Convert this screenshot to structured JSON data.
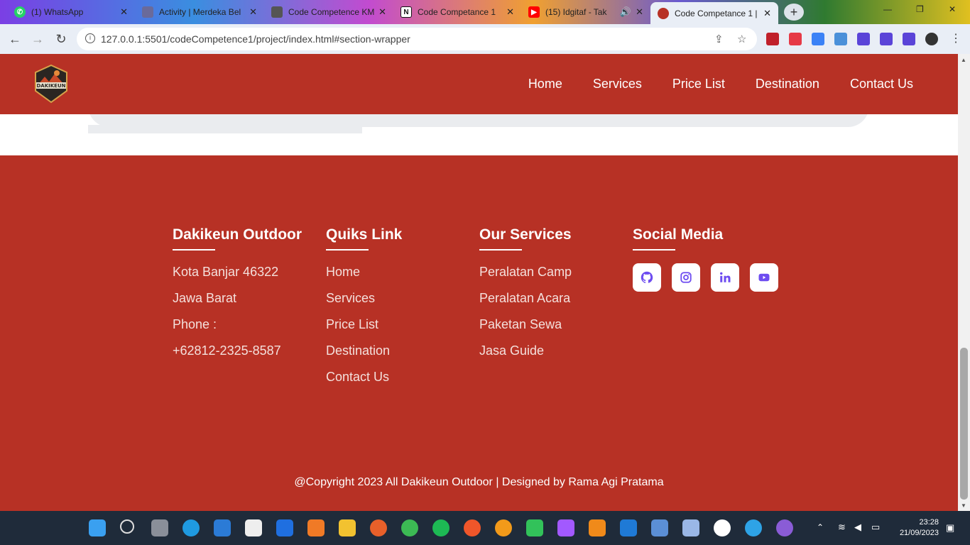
{
  "browser": {
    "tabs": [
      {
        "label": "(1) WhatsApp",
        "icon": "whatsapp-icon",
        "color": "#25d366"
      },
      {
        "label": "Activity | Merdeka Bel",
        "icon": "generic-site-icon",
        "color": "#6a6a9a"
      },
      {
        "label": "Code Competence KM",
        "icon": "generic-site-icon",
        "color": "#555"
      },
      {
        "label": "Code Competance 1",
        "icon": "notion-icon",
        "color": "#111"
      },
      {
        "label": "(15) Idgitaf - Tak",
        "icon": "youtube-icon",
        "color": "#ff0000"
      },
      {
        "label": "Code Competance 1 |",
        "icon": "site-logo-icon",
        "color": "#b73125"
      }
    ],
    "url": "127.0.0.1:5501/codeCompetence1/project/index.html#section-wrapper"
  },
  "site": {
    "brand": "DAKIKEUN",
    "nav": [
      "Home",
      "Services",
      "Price List",
      "Destination",
      "Contact Us"
    ],
    "accent": "#b73125"
  },
  "footer": {
    "about": {
      "title": "Dakikeun Outdoor",
      "lines": [
        "Kota Banjar 46322",
        "Jawa Barat",
        "Phone :",
        "+62812-2325-8587"
      ]
    },
    "links": {
      "title": "Quiks Link",
      "items": [
        "Home",
        "Services",
        "Price List",
        "Destination",
        "Contact Us"
      ]
    },
    "services": {
      "title": "Our Services",
      "items": [
        "Peralatan Camp",
        "Peralatan Acara",
        "Paketan Sewa",
        "Jasa Guide"
      ]
    },
    "social": {
      "title": "Social Media",
      "icons": [
        "github-icon",
        "instagram-icon",
        "linkedin-icon",
        "youtube-icon"
      ],
      "icon_color": "#6d4cf0"
    },
    "copyright": "@Copyright 2023 All Dakikeun Outdoor | Designed by Rama Agi Pratama"
  },
  "taskbar": {
    "time": "23:28",
    "date": "21/09/2023"
  }
}
